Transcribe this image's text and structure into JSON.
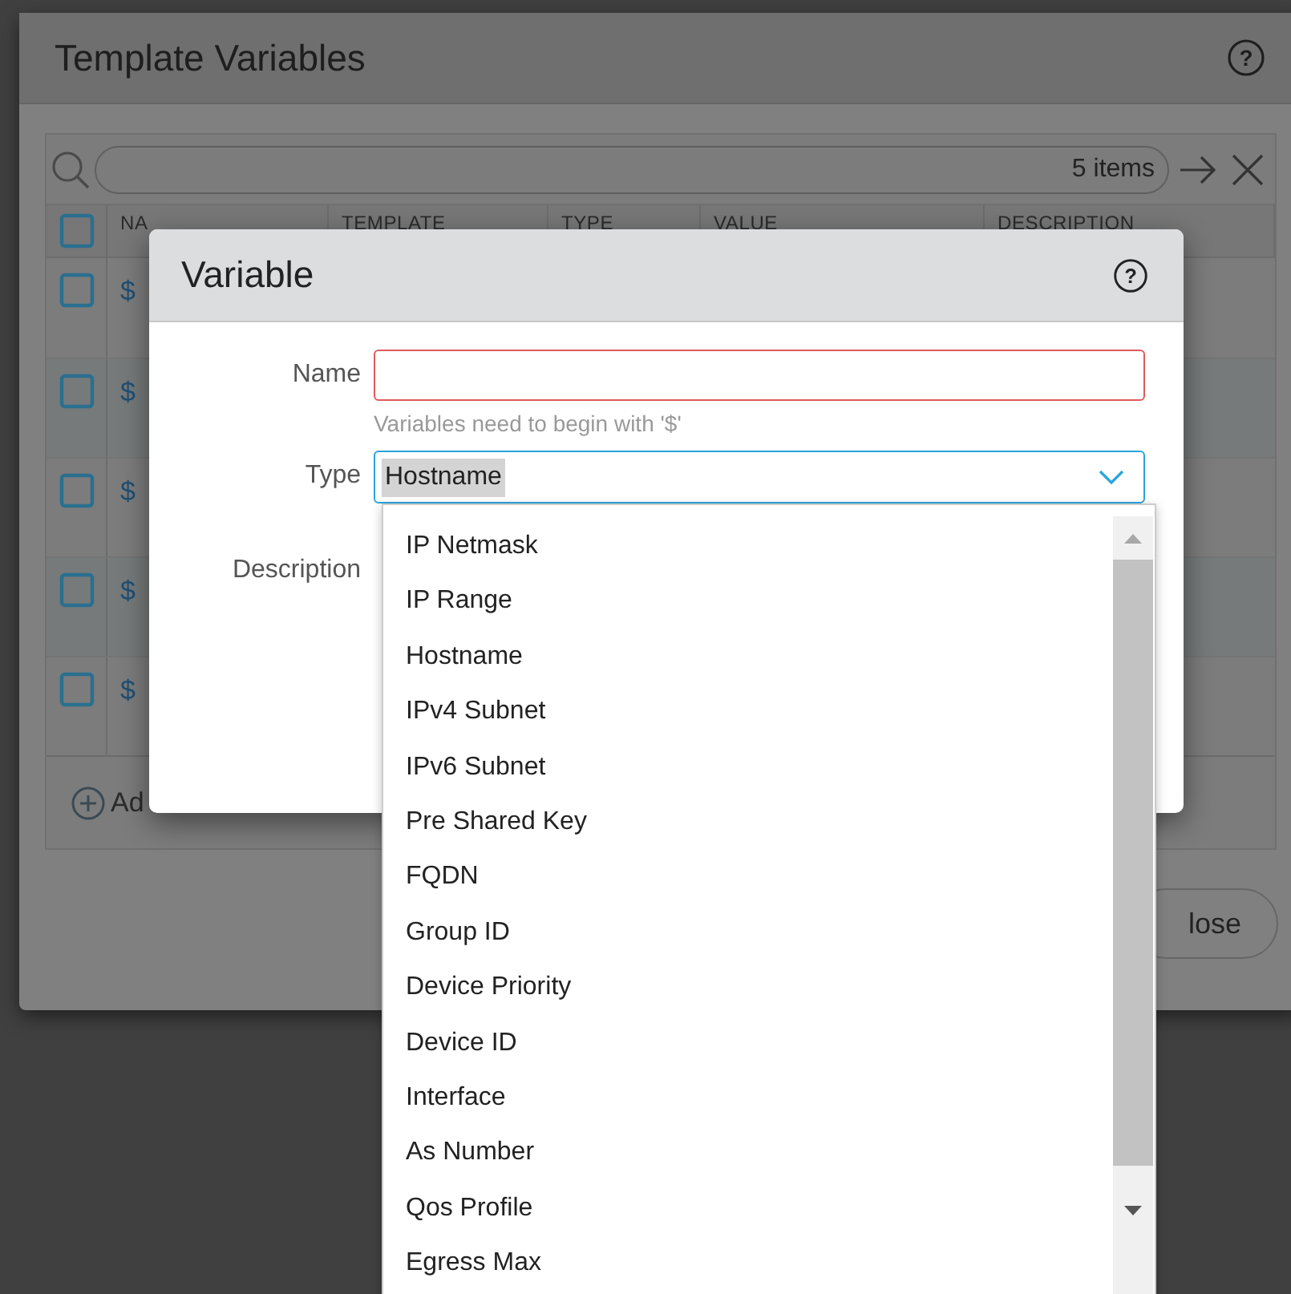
{
  "background_dialog": {
    "title": "Template Variables",
    "help_glyph": "?",
    "search": {
      "count": "5 items"
    },
    "table": {
      "columns": [
        "NA",
        "TEMPLATE",
        "TYPE",
        "VALUE",
        "DESCRIPTION"
      ],
      "header_checked": false,
      "rows": [
        {
          "name": "$",
          "checked": false
        },
        {
          "name": "$",
          "checked": false
        },
        {
          "name": "$",
          "checked": false
        },
        {
          "name": "$",
          "checked": false
        },
        {
          "name": "$",
          "checked": false
        }
      ]
    },
    "add_label": "Ad",
    "close_label": "lose"
  },
  "dialog": {
    "title": "Variable",
    "help_glyph": "?",
    "name_field": {
      "label": "Name",
      "invalid": true,
      "hint": "Variables need to begin with '$'"
    },
    "type_field": {
      "label": "Type",
      "value": "Hostname",
      "expanded": true,
      "options": [
        "IP Netmask",
        "IP Range",
        "Hostname",
        "IPv4 Subnet",
        "IPv6 Subnet",
        "Pre Shared Key",
        "FQDN",
        "Group ID",
        "Device Priority",
        "Device ID",
        "Interface",
        "As Number",
        "Qos Profile",
        "Egress Max"
      ]
    },
    "description_label": "Description"
  }
}
